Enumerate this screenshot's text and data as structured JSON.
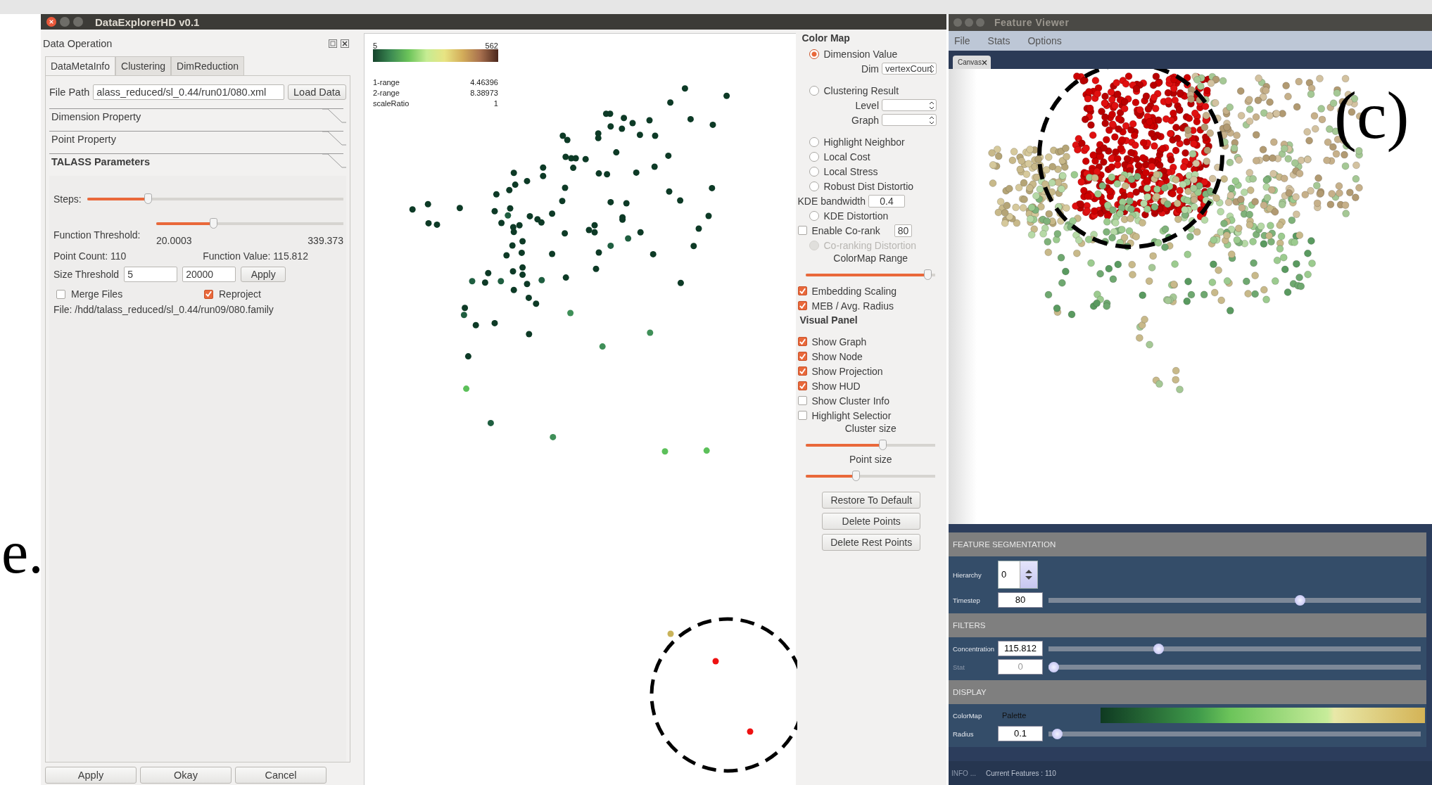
{
  "panel_label_left": "e.",
  "panel_label": "(c)",
  "main_window": {
    "title": "DataExplorerHD v0.1",
    "dock_title": "Data Operation",
    "tabs": [
      {
        "label": "DataMetaInfo",
        "selected": true
      },
      {
        "label": "Clustering",
        "selected": false
      },
      {
        "label": "DimReduction",
        "selected": false
      }
    ],
    "file_path": {
      "label": "File Path",
      "value": "alass_reduced/sl_0.44/run01/080.xml",
      "button": "Load Data"
    },
    "sections": [
      {
        "label": "Dimension Property",
        "expanded": false
      },
      {
        "label": "Point Property",
        "expanded": false
      },
      {
        "label": "TALASS Parameters",
        "expanded": true
      }
    ],
    "steps": {
      "label": "Steps:",
      "level": 0.23
    },
    "function_threshold": {
      "label": "Function Threshold:",
      "level": 0.3,
      "min": "20.0003",
      "max": "339.373"
    },
    "point_count": "Point Count: 110",
    "function_value": "Function Value: 115.812",
    "size_threshold": {
      "label": "Size Threshold",
      "min": "5",
      "max": "20000",
      "button": "Apply"
    },
    "checks": [
      {
        "label": "Merge Files",
        "checked": false
      },
      {
        "label": "Reproject",
        "checked": true
      }
    ],
    "file_info": "File: /hdd/talass_reduced/sl_0.44/run09/080.family",
    "footer_buttons": [
      "Apply",
      "Okay",
      "Cancel"
    ]
  },
  "scatter": {
    "legend_min": "5",
    "legend_max": "562",
    "stats": [
      {
        "label": "1-range",
        "value": "4.46396"
      },
      {
        "label": "2-range",
        "value": "8.38973"
      },
      {
        "label": "scaleRatio",
        "value": "1"
      }
    ]
  },
  "color_map": {
    "title": "Color Map",
    "items": [
      {
        "kind": "radio",
        "label": "Dimension Value",
        "selected": true,
        "disabled": false
      },
      {
        "kind": "select",
        "label": "Dim",
        "value": "vertexCoun"
      },
      {
        "kind": "radio",
        "label": "Clustering Result",
        "selected": false,
        "disabled": false
      },
      {
        "kind": "select",
        "label": "Level"
      },
      {
        "kind": "select",
        "label": "Graph"
      },
      {
        "kind": "radio",
        "label": "Highlight Neighbor",
        "selected": false,
        "disabled": false
      },
      {
        "kind": "radio",
        "label": "Local Cost",
        "selected": false,
        "disabled": false
      },
      {
        "kind": "radio",
        "label": "Local Stress",
        "selected": false,
        "disabled": false
      },
      {
        "kind": "radio",
        "label": "Robust Dist Distortio",
        "selected": false,
        "disabled": false
      },
      {
        "kind": "field",
        "label": "KDE bandwidth",
        "value": "0.4"
      },
      {
        "kind": "radio",
        "label": "KDE Distortion",
        "selected": false,
        "disabled": false
      },
      {
        "kind": "check",
        "label": "Enable Co-rank",
        "checked": false,
        "value": "80"
      },
      {
        "kind": "radio",
        "label": "Co-ranking Distortion",
        "selected": false,
        "disabled": true
      },
      {
        "kind": "slider",
        "label": "ColorMap Range",
        "level": 0.97
      },
      {
        "kind": "check",
        "label": "Embedding Scaling",
        "checked": true
      },
      {
        "kind": "check",
        "label": "MEB / Avg. Radius",
        "checked": true
      }
    ]
  },
  "visual_panel": {
    "title": "Visual Panel",
    "items": [
      {
        "kind": "check",
        "label": "Show Graph",
        "checked": true
      },
      {
        "kind": "check",
        "label": "Show Node",
        "checked": true
      },
      {
        "kind": "check",
        "label": "Show Projection",
        "checked": true
      },
      {
        "kind": "check",
        "label": "Show HUD",
        "checked": true
      },
      {
        "kind": "check",
        "label": "Show Cluster Info",
        "checked": false
      },
      {
        "kind": "check",
        "label": "Highlight Selectior",
        "checked": false
      },
      {
        "kind": "slider",
        "label": "Cluster size",
        "level": 0.6
      },
      {
        "kind": "slider",
        "label": "Point size",
        "level": 0.38
      }
    ],
    "buttons": [
      "Restore To Default",
      "Delete Points",
      "Delete Rest Points"
    ]
  },
  "feature_viewer": {
    "title": "Feature Viewer",
    "menu": [
      "File",
      "Stats",
      "Options"
    ],
    "tab": {
      "label": "Canvas",
      "selected": true
    },
    "sections": [
      {
        "title": "FEATURE SEGMENTATION",
        "rows": [
          {
            "kind": "spin",
            "label": "Hierarchy",
            "value": "0"
          },
          {
            "kind": "slider",
            "label": "Timestep",
            "value": "80",
            "level": 0.68,
            "disabled": false
          }
        ]
      },
      {
        "title": "FILTERS",
        "rows": [
          {
            "kind": "slider",
            "label": "Concentration",
            "value": "115.812",
            "level": 0.29,
            "disabled": false
          },
          {
            "kind": "slider",
            "label": "Stat",
            "value": "0",
            "level": 0.0,
            "disabled": true
          }
        ]
      },
      {
        "title": "DISPLAY",
        "rows": [
          {
            "kind": "colormap",
            "label": "ColorMap",
            "value": "Palette"
          },
          {
            "kind": "slider",
            "label": "Radius",
            "value": "0.1",
            "level": 0.01,
            "disabled": false
          }
        ]
      }
    ],
    "status": {
      "label": "INFO ...",
      "text": "Current Features : 110"
    }
  }
}
